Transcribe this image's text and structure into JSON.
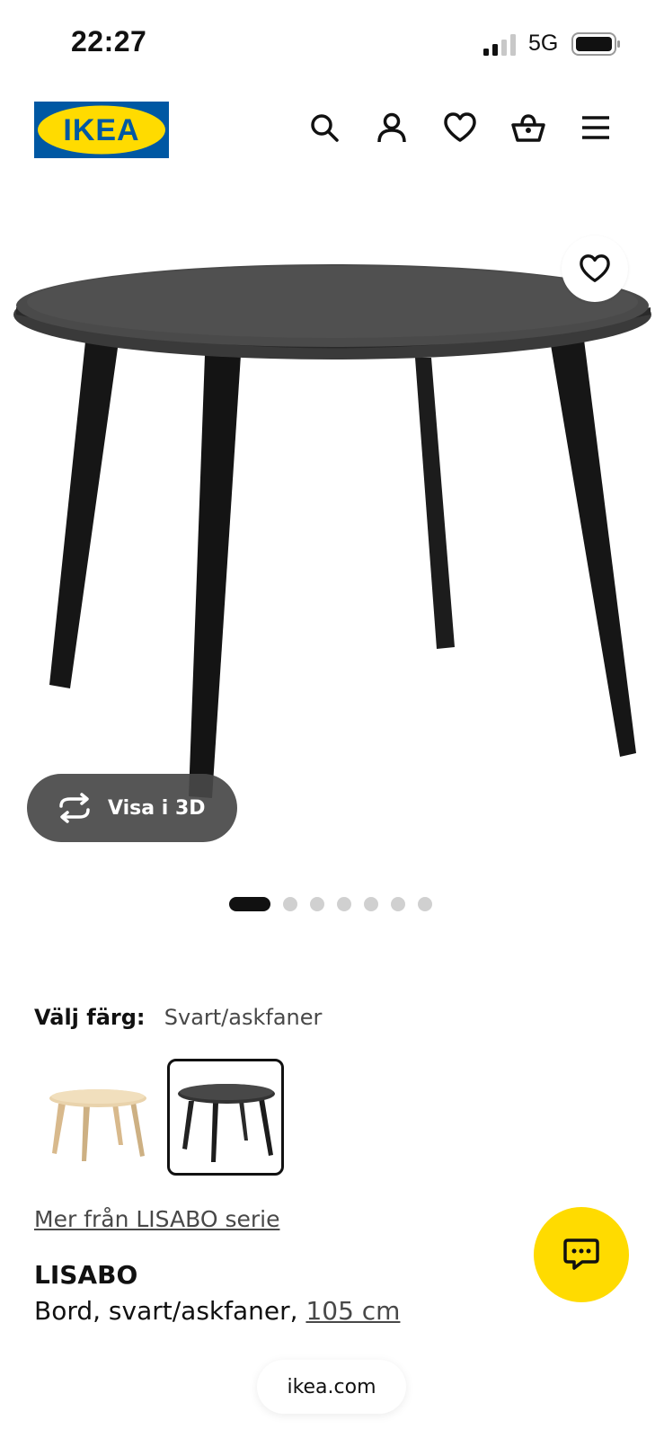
{
  "status_bar": {
    "time": "22:27",
    "network": "5G",
    "icons": [
      "signal-icon",
      "battery-icon"
    ]
  },
  "header": {
    "logo_text": "IKEA",
    "brand_colors": {
      "blue": "#0058a3",
      "yellow": "#ffdb00"
    },
    "icons": [
      "search-icon",
      "account-icon",
      "heart-icon",
      "basket-icon",
      "menu-icon"
    ]
  },
  "gallery": {
    "view_3d_label": "Visa i 3D",
    "image_count": 7,
    "active_index": 0
  },
  "product": {
    "color_label": "Välj färg:",
    "color_value": "Svart/askfaner",
    "swatches": [
      {
        "name": "light",
        "selected": false
      },
      {
        "name": "black",
        "selected": true
      }
    ],
    "series_link": "Mer från LISABO serie",
    "name": "LISABO",
    "description_prefix": "Bord, svart/askfaner, ",
    "size": "105 cm"
  },
  "chat": {
    "icon": "chat-icon"
  },
  "browser": {
    "url": "ikea.com"
  }
}
